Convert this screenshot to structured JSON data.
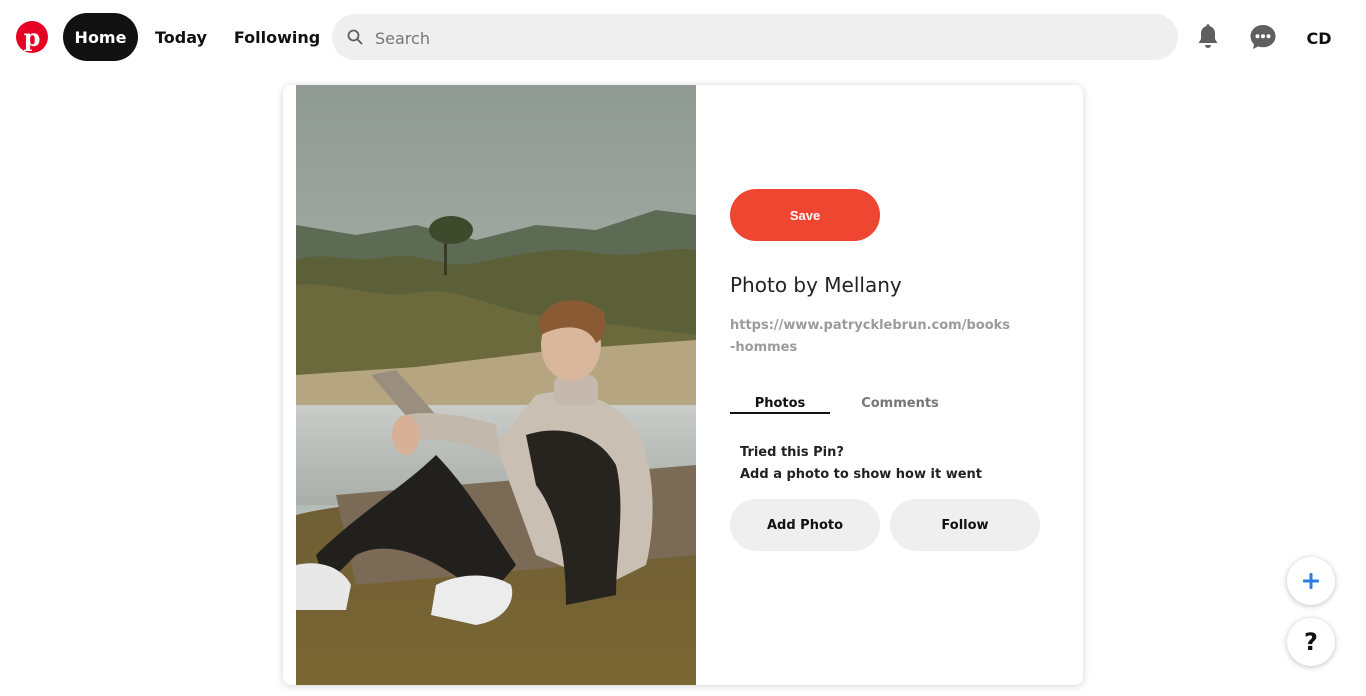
{
  "header": {
    "logo_icon": "pinterest-logo-icon",
    "logo_glyph": "p",
    "nav": [
      {
        "label": "Home",
        "active": true
      },
      {
        "label": "Today",
        "active": false
      },
      {
        "label": "Following",
        "active": false
      }
    ],
    "search": {
      "placeholder": "Search",
      "value": ""
    },
    "notifications_icon": "bell-icon",
    "messages_icon": "chat-bubble-icon",
    "account_initials": "CD"
  },
  "pin": {
    "image_icon": "man-sitting-by-lake-photo",
    "save_label": "Save",
    "title": "Photo by Mellany",
    "source_url": "https://www.patrycklebrun.com/books-hommes",
    "tabs": [
      {
        "label": "Photos",
        "active": true
      },
      {
        "label": "Comments",
        "active": false
      }
    ],
    "tried_title": "Tried this Pin?",
    "tried_subtitle": "Add a photo to show how it went",
    "add_photo_label": "Add Photo",
    "follow_label": "Follow"
  },
  "floating": {
    "create_icon": "plus-icon",
    "help_label": "?"
  },
  "colors": {
    "brand": "#e60023",
    "save_button": "#ef4632",
    "nav_active_bg": "#111111",
    "button_gray": "#efefef",
    "plus_accent": "#2a7de1"
  }
}
